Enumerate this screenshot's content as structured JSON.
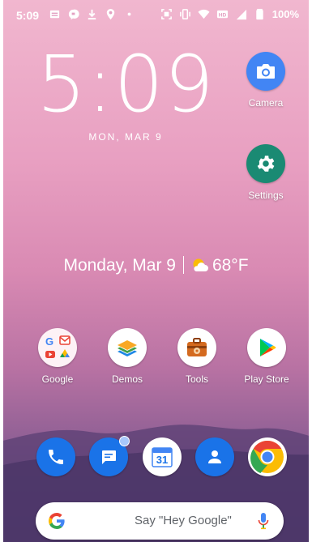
{
  "status_bar": {
    "time": "5:09",
    "battery": "100%"
  },
  "clock": {
    "time": "5:09",
    "date": "MON, MAR 9"
  },
  "at_a_glance": {
    "date": "Monday, Mar 9",
    "temperature": "68°F"
  },
  "shortcuts": [
    {
      "label": "Camera",
      "icon": "camera-icon",
      "color": "#4285f4"
    },
    {
      "label": "Settings",
      "icon": "gear-icon",
      "color": "#1a8a73"
    }
  ],
  "home_apps": [
    {
      "label": "Google",
      "icon": "google-folder-icon"
    },
    {
      "label": "Demos",
      "icon": "layers-icon"
    },
    {
      "label": "Tools",
      "icon": "toolbox-icon"
    },
    {
      "label": "Play Store",
      "icon": "play-store-icon"
    }
  ],
  "dock": [
    {
      "name": "phone",
      "icon": "phone-icon",
      "color": "#1a73e8"
    },
    {
      "name": "messages",
      "icon": "messages-icon",
      "color": "#1a73e8"
    },
    {
      "name": "calendar",
      "icon": "calendar-icon",
      "day": "31"
    },
    {
      "name": "contacts",
      "icon": "contacts-icon",
      "color": "#1a73e8"
    },
    {
      "name": "chrome",
      "icon": "chrome-icon"
    }
  ],
  "search": {
    "placeholder": "Say \"Hey Google\""
  }
}
